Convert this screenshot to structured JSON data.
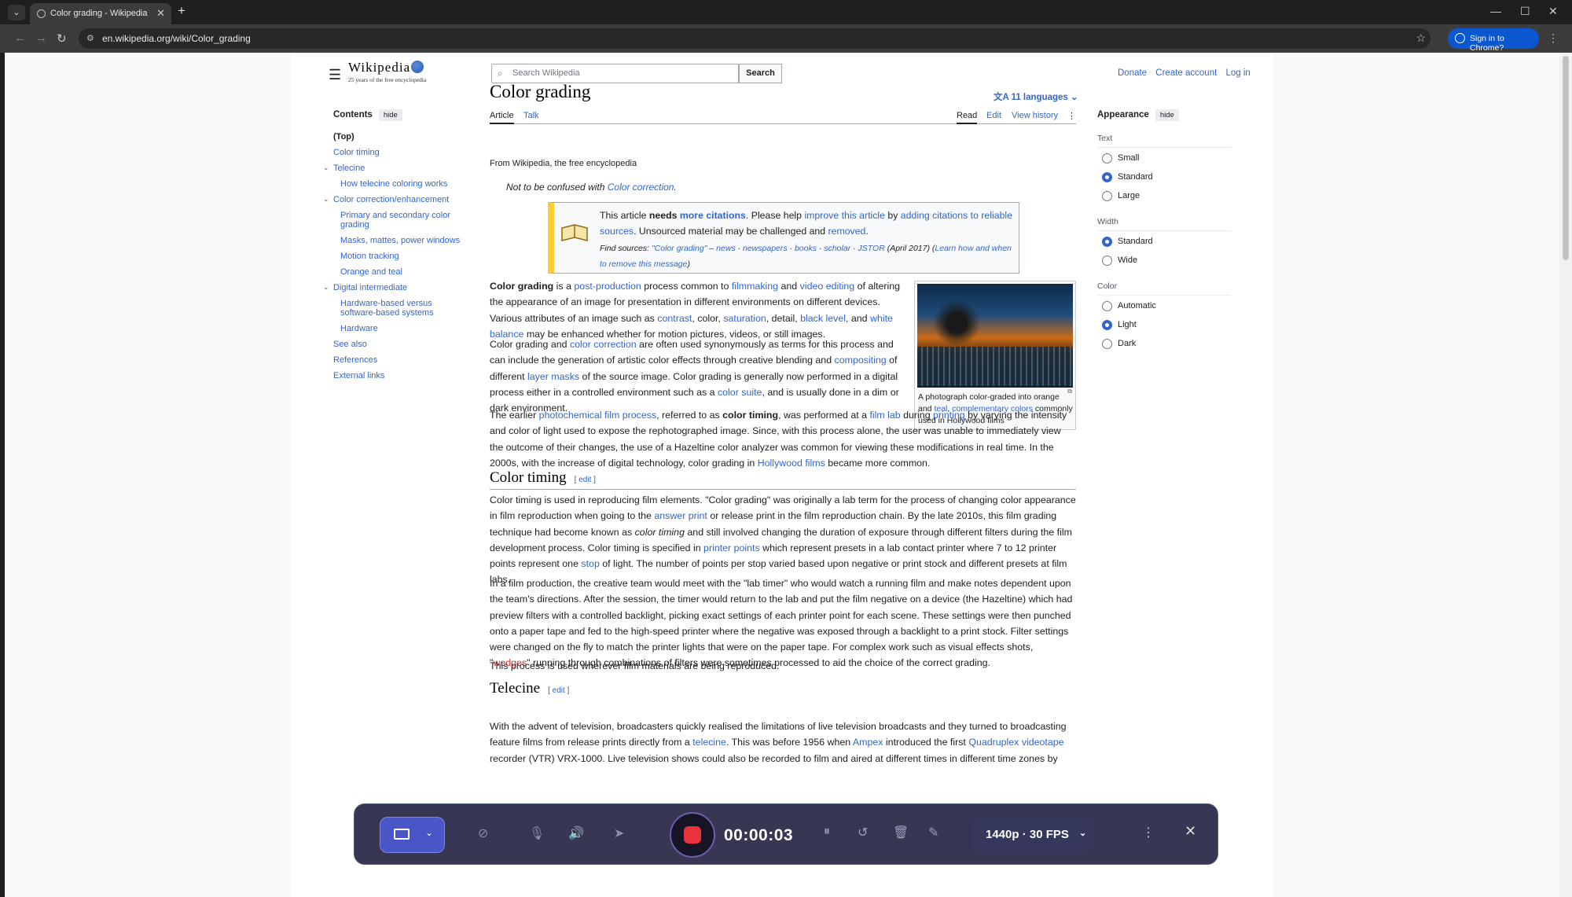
{
  "browser": {
    "tab_title": "Color grading - Wikipedia",
    "url": "en.wikipedia.org/wiki/Color_grading",
    "sign_in": "Sign in to Chrome?"
  },
  "wiki": {
    "logo": "Wikipedia",
    "tagline": "25 years of the free encyclopedia",
    "search_placeholder": "Search Wikipedia",
    "search_button": "Search",
    "user_links": [
      "Donate",
      "Create account",
      "Log in"
    ]
  },
  "toc": {
    "title": "Contents",
    "hide": "hide",
    "items": [
      {
        "label": "(Top)",
        "level": 0
      },
      {
        "label": "Color timing",
        "level": 0
      },
      {
        "label": "Telecine",
        "level": 0,
        "expandable": true
      },
      {
        "label": "How telecine coloring works",
        "level": 1
      },
      {
        "label": "Color correction/enhancement",
        "level": 0,
        "expandable": true
      },
      {
        "label": "Primary and secondary color grading",
        "level": 1
      },
      {
        "label": "Masks, mattes, power windows",
        "level": 1
      },
      {
        "label": "Motion tracking",
        "level": 1
      },
      {
        "label": "Orange and teal",
        "level": 1
      },
      {
        "label": "Digital intermediate",
        "level": 0,
        "expandable": true
      },
      {
        "label": "Hardware-based versus software-based systems",
        "level": 1
      },
      {
        "label": "Hardware",
        "level": 1
      },
      {
        "label": "See also",
        "level": 0
      },
      {
        "label": "References",
        "level": 0
      },
      {
        "label": "External links",
        "level": 0
      }
    ]
  },
  "article": {
    "title": "Color grading",
    "languages": "11 languages",
    "tabs_left": [
      "Article",
      "Talk"
    ],
    "tabs_right": [
      "Read",
      "Edit",
      "View history"
    ],
    "from": "From Wikipedia, the free encyclopedia",
    "hatnote_prefix": "Not to be confused with",
    "hatnote_link": "Color correction",
    "ambox": {
      "t1_a": "This article",
      "t1_b": "needs",
      "t1_c": "more citations",
      "t1_d": ". Please help",
      "t1_e": "improve this article",
      "t1_f": "by",
      "t1_g": "adding citations to reliable sources",
      "t1_h": ". Unsourced material may be challenged and",
      "t1_i": "removed",
      "t2_a": "Find sources:",
      "t2_b": "\"Color grading\"",
      "t2_c": "news",
      "t2_d": "newspapers",
      "t2_e": "books",
      "t2_f": "scholar",
      "t2_g": "JSTOR",
      "t2_h": "(April 2017)",
      "t2_i": "Learn how and when to remove this message"
    },
    "image_caption_a": "A photograph color-graded into orange and",
    "image_caption_b": "teal",
    "image_caption_c": "complementary colors",
    "image_caption_d": "commonly used in Hollywood films",
    "section_color_timing": "Color timing",
    "section_telecine": "Telecine",
    "edit": "edit"
  },
  "appearance": {
    "title": "Appearance",
    "hide": "hide",
    "text_label": "Text",
    "text_options": [
      "Small",
      "Standard",
      "Large"
    ],
    "text_selected": "Standard",
    "width_label": "Width",
    "width_options": [
      "Standard",
      "Wide"
    ],
    "width_selected": "Standard",
    "color_label": "Color",
    "color_options": [
      "Automatic",
      "Light",
      "Dark"
    ],
    "color_selected": "Light"
  },
  "recorder": {
    "timer": "00:00:03",
    "resolution": "1440p · 30 FPS"
  },
  "colors": {
    "link": "#3366cc",
    "accent": "#0b57d0",
    "record": "#e8323c"
  }
}
